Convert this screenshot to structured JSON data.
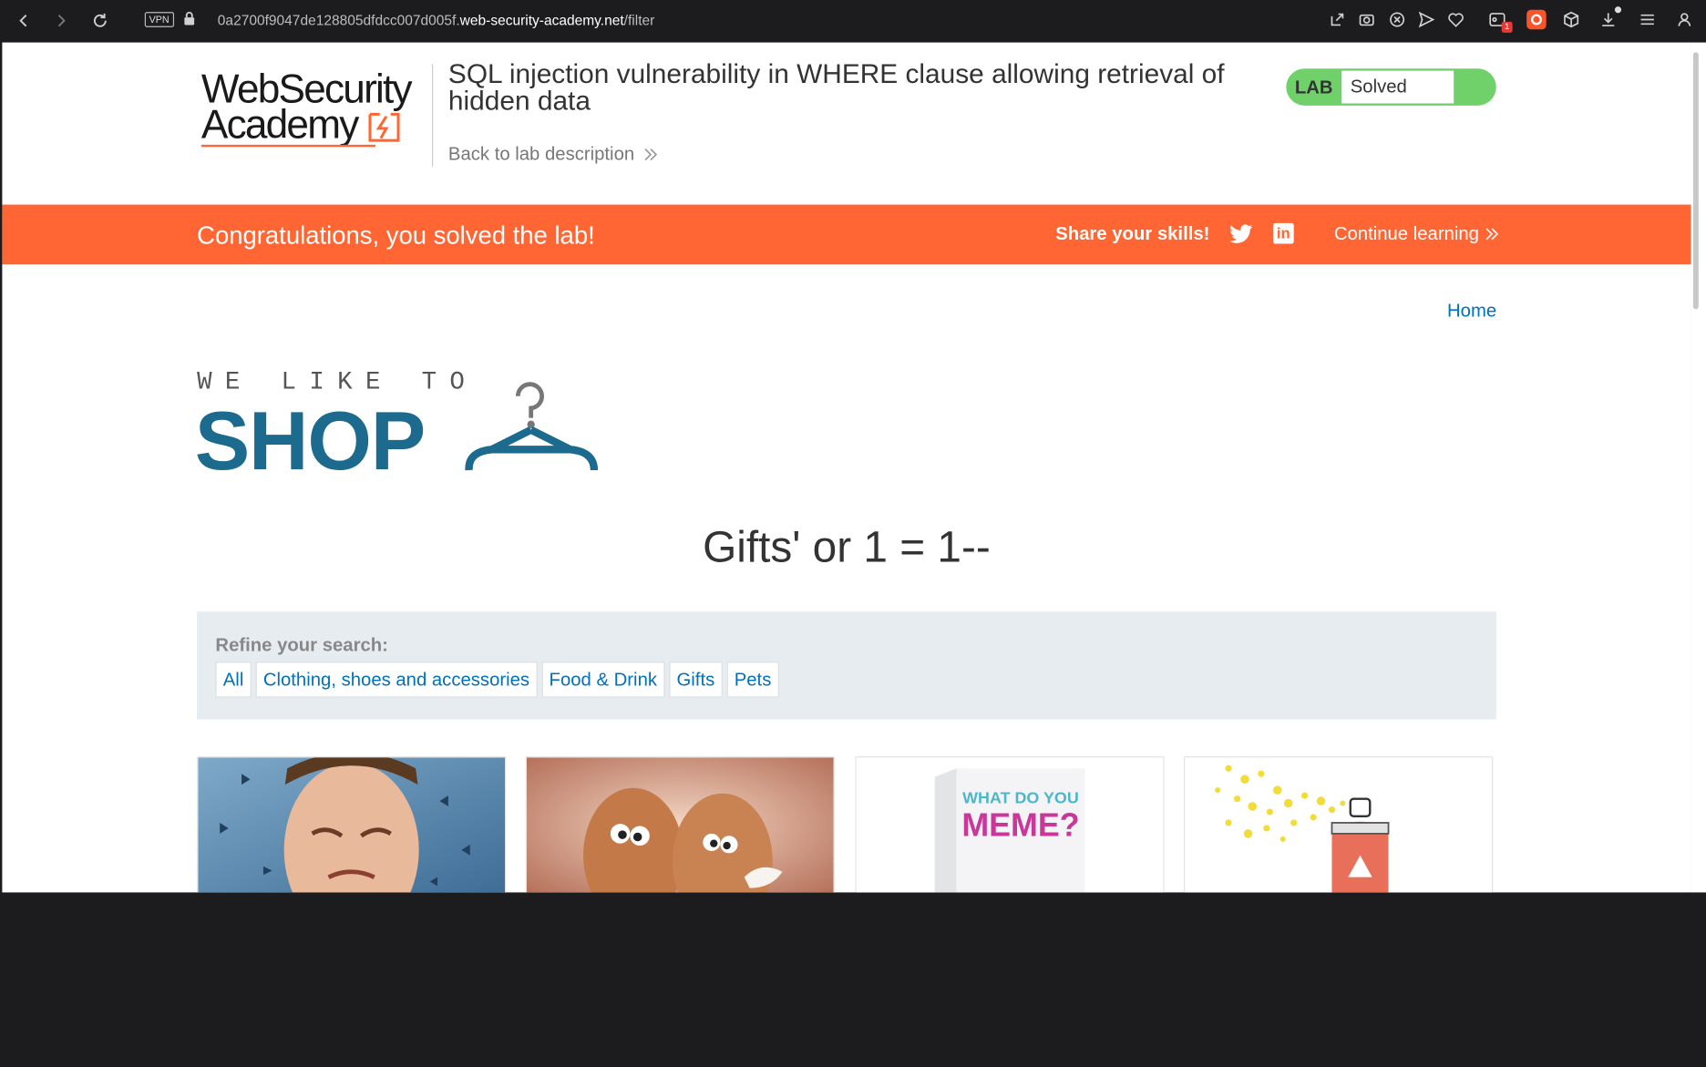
{
  "browser": {
    "vpn_label": "VPN",
    "url_prefix": "0a2700f9047de128805dfdcc007d005f.",
    "url_domain": "web-security-academy.net",
    "url_path": "/filter",
    "extension_badge": "1"
  },
  "header": {
    "logo_line1": "WebSecurity",
    "logo_line2": "Academy",
    "lab_title": "SQL injection vulnerability in WHERE clause allowing retrieval of hidden data",
    "back_link": "Back to lab description",
    "lab_label": "LAB",
    "lab_status": "Solved",
    "status_color": "#70d16b"
  },
  "banner": {
    "message": "Congratulations, you solved the lab!",
    "share": "Share your skills!",
    "continue": "Continue learning",
    "color": "#ff6633"
  },
  "nav": {
    "home": "Home"
  },
  "shop_logo": {
    "line1": "WE LIKE TO",
    "line2": "SHOP"
  },
  "search": {
    "title": "Gifts' or 1 = 1--"
  },
  "filter": {
    "label": "Refine your search:",
    "categories": [
      "All",
      "Clothing, shoes and accessories",
      "Food & Drink",
      "Gifts",
      "Pets"
    ]
  },
  "products": [
    {
      "image": "sneezing-man"
    },
    {
      "image": "cartoon-eggs"
    },
    {
      "image": "meme-card-game",
      "box_text_1": "WHAT DO YOU",
      "box_text_2": "MEME?"
    },
    {
      "image": "spray-can"
    }
  ]
}
